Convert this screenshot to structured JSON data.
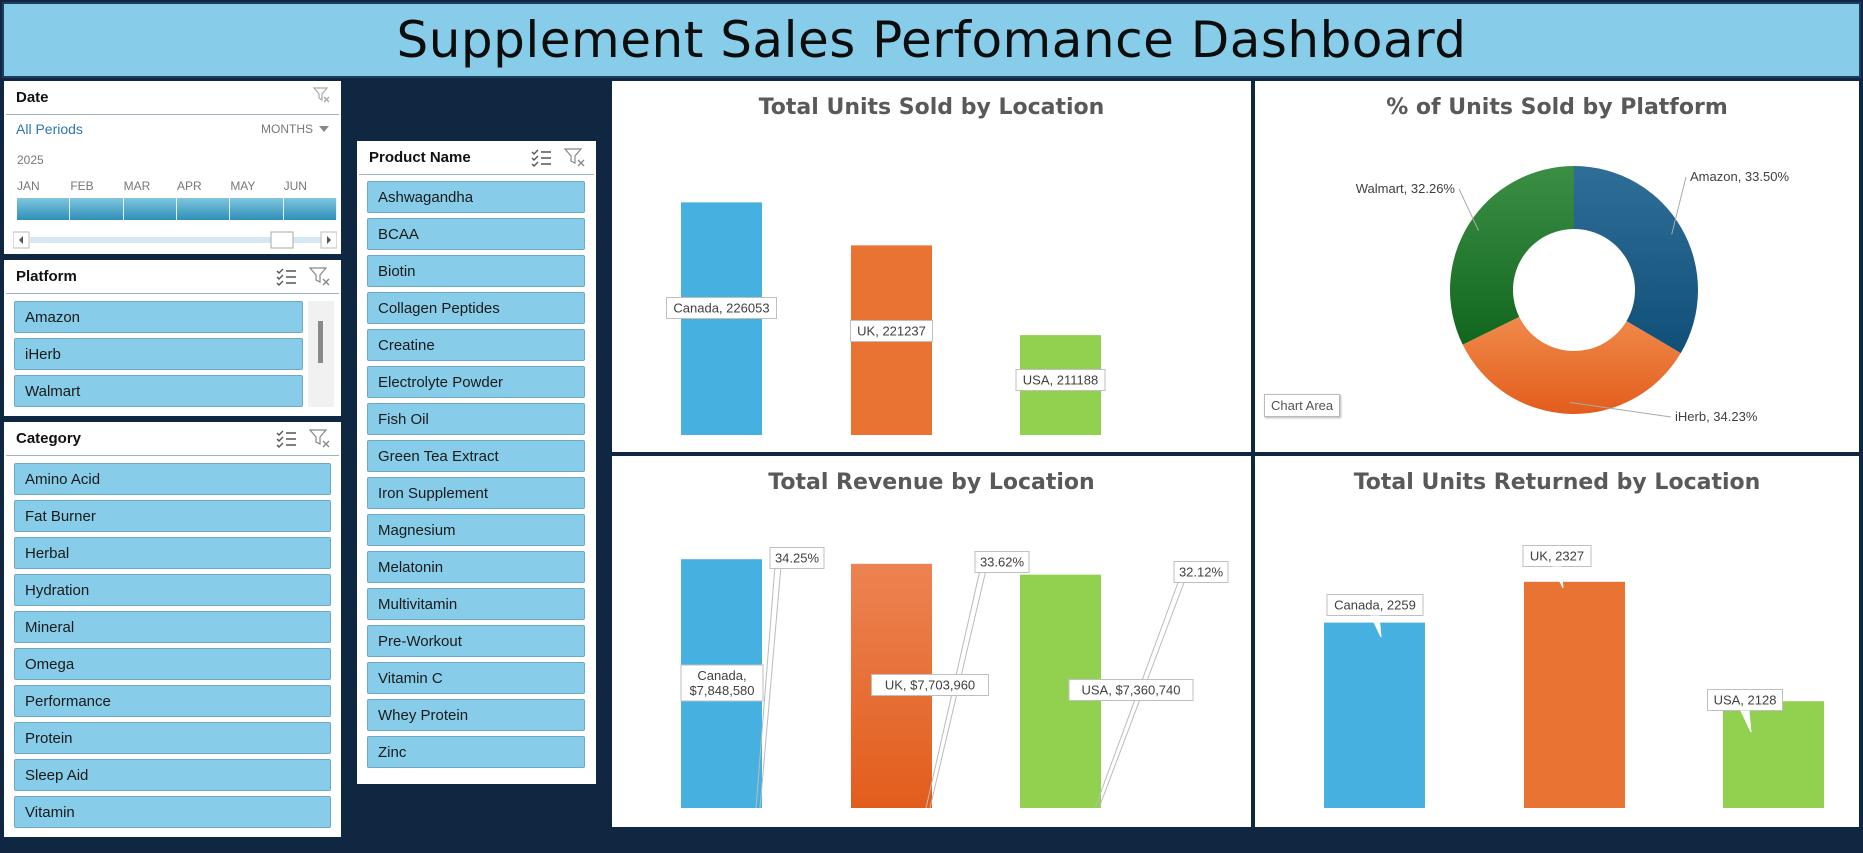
{
  "dashboard": {
    "title": "Supplement Sales Perfomance Dashboard"
  },
  "date_slicer": {
    "label": "Date",
    "period_label": "All Periods",
    "granularity": "MONTHS",
    "year": "2025",
    "months": [
      "JAN",
      "FEB",
      "MAR",
      "APR",
      "MAY",
      "JUN"
    ]
  },
  "platform_slicer": {
    "label": "Platform",
    "items": [
      "Amazon",
      "iHerb",
      "Walmart"
    ]
  },
  "category_slicer": {
    "label": "Category",
    "items": [
      "Amino Acid",
      "Fat Burner",
      "Herbal",
      "Hydration",
      "Mineral",
      "Omega",
      "Performance",
      "Protein",
      "Sleep Aid",
      "Vitamin"
    ]
  },
  "product_slicer": {
    "label": "Product Name",
    "items": [
      "Ashwagandha",
      "BCAA",
      "Biotin",
      "Collagen Peptides",
      "Creatine",
      "Electrolyte Powder",
      "Fish Oil",
      "Green Tea Extract",
      "Iron Supplement",
      "Magnesium",
      "Melatonin",
      "Multivitamin",
      "Pre-Workout",
      "Vitamin C",
      "Whey Protein",
      "Zinc"
    ]
  },
  "chart_area_tooltip": "Chart Area",
  "colors": {
    "canada": "#46b0e0",
    "uk": "#e87333",
    "usa": "#92d050",
    "amazon": "#1f5f8b",
    "iherb": "#ee7d3b",
    "walmart": "#2e7d32"
  },
  "chart_data": [
    {
      "type": "bar",
      "title": "Total Units Sold by Location",
      "categories": [
        "Canada",
        "UK",
        "USA"
      ],
      "values": [
        226053,
        221237,
        211188
      ],
      "data_labels": [
        "Canada, 226053",
        "UK, 221237",
        "USA, 211188"
      ],
      "ylim": [
        200000,
        228000
      ]
    },
    {
      "type": "pie",
      "title": "% of Units Sold by Platform",
      "labels": [
        "Amazon",
        "iHerb",
        "Walmart"
      ],
      "values": [
        33.5,
        34.23,
        32.26
      ],
      "data_labels": [
        "Amazon, 33.50%",
        "iHerb, 34.23%",
        "Walmart, 32.26%"
      ]
    },
    {
      "type": "bar",
      "title": "Total Revenue by Location",
      "categories": [
        "Canada",
        "UK",
        "USA"
      ],
      "values": [
        7848580,
        7703960,
        7360740
      ],
      "data_labels": [
        "Canada, $7,848,580",
        "UK,  $7,703,960",
        "USA,  $7,360,740"
      ],
      "percent_labels": [
        "34.25%",
        "33.62%",
        "32.12%"
      ],
      "ylim": [
        0,
        7950000
      ]
    },
    {
      "type": "bar",
      "title": "Total Units Returned by Location",
      "categories": [
        "Canada",
        "UK",
        "USA"
      ],
      "values": [
        2259,
        2327,
        2128
      ],
      "data_labels": [
        "Canada, 2259",
        "UK, 2327",
        "USA, 2128"
      ],
      "ylim": [
        1950,
        2340
      ]
    }
  ]
}
